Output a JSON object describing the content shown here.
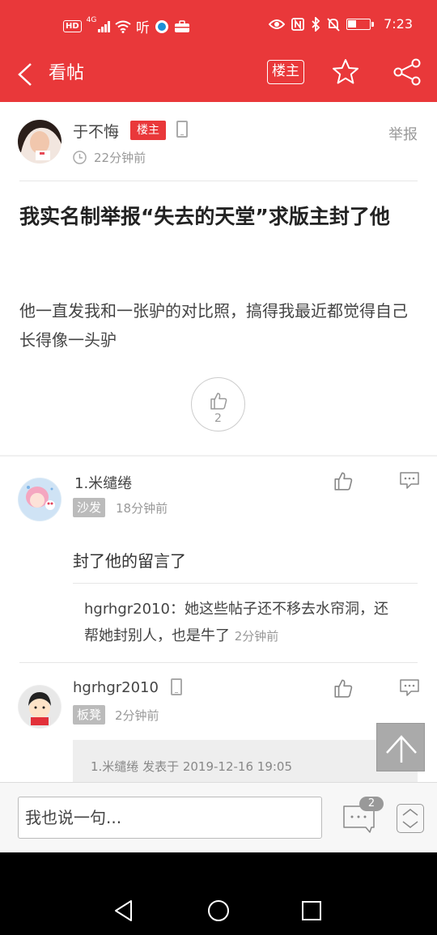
{
  "status": {
    "time": "7:23",
    "network": "4G",
    "hd": "HD",
    "extra": "听"
  },
  "nav": {
    "title": "看帖",
    "owner_label": "楼主"
  },
  "post": {
    "author": "于不悔",
    "owner_badge": "楼主",
    "time": "22分钟前",
    "report": "举报",
    "title": "我实名制举报“失去的天堂”求版主封了他",
    "body": "他一直发我和一张驴的对比照，搞得我最近都觉得自己长得像一头驴",
    "likes": "2"
  },
  "replies": [
    {
      "name": "1.米缱绻",
      "tag": "沙发",
      "time": "18分钟前",
      "text": "封了他的留言了",
      "sub_reply": {
        "author": "hgrhgr2010",
        "text": "：她这些帖子还不移去水帘洞，还帮她封别人，也是牛了",
        "time": "2分钟前"
      }
    },
    {
      "name": "hgrhgr2010",
      "tag": "板凳",
      "time": "2分钟前",
      "quote": "1.米缱绻 发表于 2019-12-16 19:05"
    }
  ],
  "bottom": {
    "placeholder": "我也说一句...",
    "comment_count": "2"
  },
  "colors": {
    "brand_red": "#e9383a",
    "tag_grey": "#bbbbbb"
  }
}
